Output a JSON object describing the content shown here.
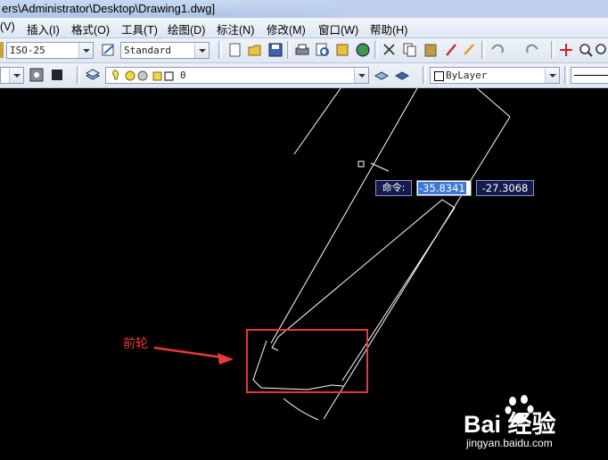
{
  "window": {
    "title": "ers\\Administrator\\Desktop\\Drawing1.dwg]"
  },
  "menu": [
    "(V)",
    "插入(I)",
    "格式(O)",
    "工具(T)",
    "绘图(D)",
    "标注(N)",
    "修改(M)",
    "窗口(W)",
    "帮助(H)"
  ],
  "toolbar": {
    "dim_style": "ISO-25",
    "text_style": "Standard",
    "layer_value": "0",
    "color_value": "ByLayer"
  },
  "dynamic_input": {
    "prompt": "命令:",
    "x_value": "-35.8341",
    "y_value": "-27.3068"
  },
  "annotation": {
    "label": "前轮",
    "color": "#e8383a"
  },
  "watermark": {
    "brand": "Bai 经验",
    "url": "jingyan.baidu.com"
  },
  "colors": {
    "canvas": "#000000",
    "lines": "#ffffff",
    "highlight_box": "#e8383a"
  }
}
